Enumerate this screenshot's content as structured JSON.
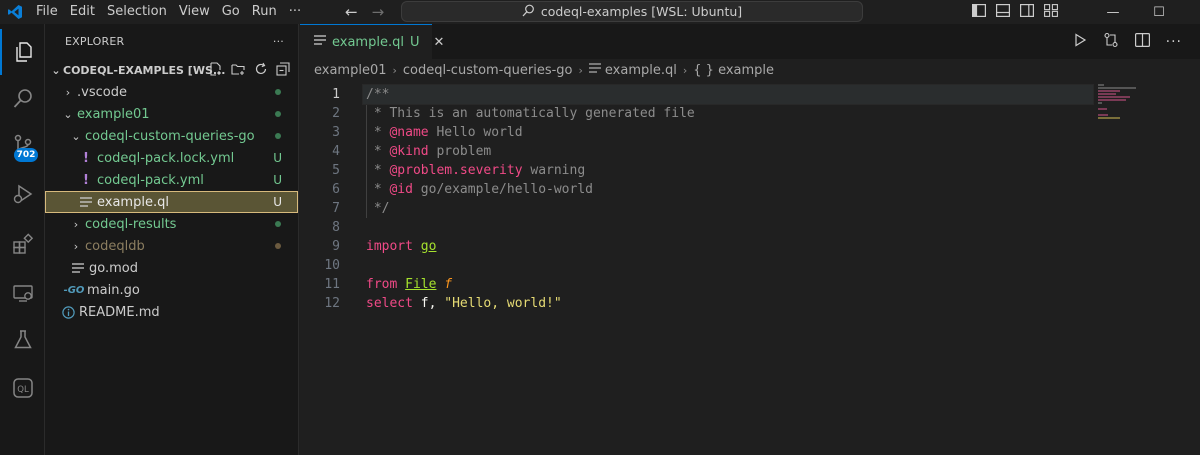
{
  "titlebar": {
    "menu": [
      "File",
      "Edit",
      "Selection",
      "View",
      "Go",
      "Run",
      "···"
    ],
    "command_center": "codeql-examples [WSL: Ubuntu]",
    "controls": {
      "minimize": "—",
      "maximize": "☐",
      "close": "✕"
    }
  },
  "activity": {
    "scm_badge": "702",
    "ql_label": "QL"
  },
  "sidebar": {
    "title": "EXPLORER",
    "more": "···",
    "section_title": "CODEQL-EXAMPLES [WS...",
    "tree": [
      {
        "label": ".vscode",
        "status": "dot"
      },
      {
        "label": "example01",
        "status": "dot"
      },
      {
        "label": "codeql-custom-queries-go",
        "status": "dot"
      },
      {
        "label": "codeql-pack.lock.yml",
        "status": "U"
      },
      {
        "label": "codeql-pack.yml",
        "status": "U"
      },
      {
        "label": "example.ql",
        "status": "U"
      },
      {
        "label": "codeql-results",
        "status": "dot"
      },
      {
        "label": "codeqldb",
        "status": "dot"
      },
      {
        "label": "go.mod",
        "status": ""
      },
      {
        "label": "main.go",
        "status": ""
      },
      {
        "label": "README.md",
        "status": ""
      }
    ]
  },
  "editor": {
    "tab": {
      "label": "example.ql",
      "status": "U"
    },
    "breadcrumbs": [
      "example01",
      "codeql-custom-queries-go",
      "example.ql",
      "{ } example"
    ],
    "lines": [
      {
        "n": "1"
      },
      {
        "n": "2"
      },
      {
        "n": "3"
      },
      {
        "n": "4"
      },
      {
        "n": "5"
      },
      {
        "n": "6"
      },
      {
        "n": "7"
      },
      {
        "n": "8"
      },
      {
        "n": "9"
      },
      {
        "n": "10"
      },
      {
        "n": "11"
      },
      {
        "n": "12"
      }
    ],
    "code": {
      "l1": "/**",
      "l2": " * This is an automatically generated file",
      "l3_tag": "@name",
      "l3_text": " Hello world",
      "l4_tag": "@kind",
      "l4_text": " problem",
      "l5_tag": "@problem.severity",
      "l5_text": " warning",
      "l6_tag": "@id",
      "l6_text": " go/example/hello-world",
      "l7": " */",
      "l9_kw": "import",
      "l9_mod": "go",
      "l11_kw": "from",
      "l11_type": "File",
      "l11_var": "f",
      "l12_kw": "select",
      "l12_var": "f",
      "l12_str": "\"Hello, world!\""
    }
  },
  "colors": {
    "accent": "#0078d4",
    "git_untracked": "#73c991",
    "selection": "#5a5535"
  }
}
